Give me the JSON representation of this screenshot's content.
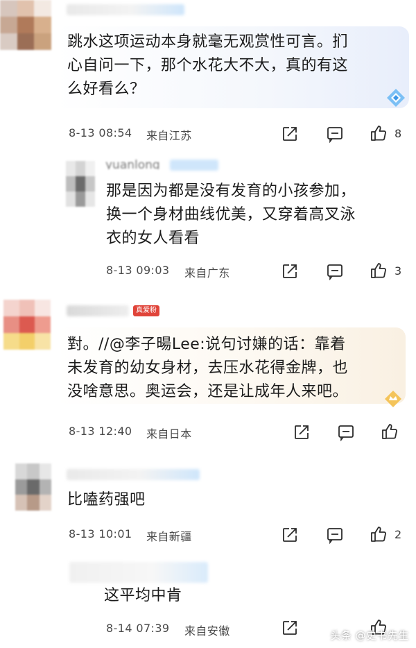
{
  "comments": [
    {
      "text": "跳水这项运动本身就毫无观赏性可言。扪\n心自问一下，那个水花大不大，真的有这\n么好看么？",
      "time": "8-13 08:54",
      "location": "来自江苏",
      "likes": "8"
    },
    {
      "username_partial": "yuanlong",
      "text": "那是因为都是没有发育的小孩参加，\n换一个身材曲线优美，又穿着高叉泳\n衣的女人看看",
      "time": "8-13 09:03",
      "location": "来自广东",
      "likes": "3"
    },
    {
      "tag": "真爱粉",
      "text": "對。//@李子暘Lee:说句讨嫌的话：靠着\n未发育的幼女身材，去压水花得金牌，也\n没啥意思。奥运会，还是让成年人来吧。",
      "time": "8-13 12:40",
      "location": "来自日本",
      "likes": ""
    },
    {
      "text": "比嗑药强吧",
      "time": "8-13 10:01",
      "location": "来自新疆",
      "likes": "2"
    },
    {
      "text": "这平均中肯",
      "time": "8-14 07:39",
      "location": "来自安徽",
      "likes": ""
    }
  ],
  "icons": {
    "share": "share-icon",
    "comment": "comment-icon",
    "like": "thumbs-up-icon"
  },
  "watermark": "头条 @史书先生",
  "colors": {
    "bubble_blue": "#eef3fb",
    "bubble_warm": "#fbf5ea",
    "tag_red": "#e0443a"
  }
}
